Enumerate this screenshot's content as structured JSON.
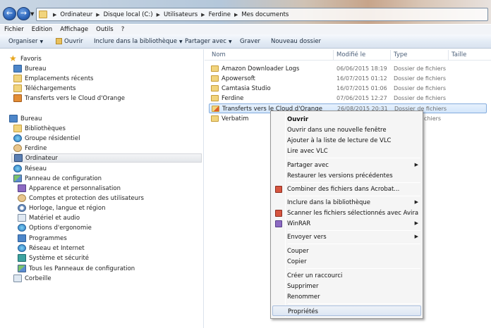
{
  "address": {
    "crumbs": [
      "Ordinateur",
      "Disque local (C:)",
      "Utilisateurs",
      "Ferdine",
      "Mes documents"
    ]
  },
  "menubar": {
    "items": [
      "Fichier",
      "Edition",
      "Affichage",
      "Outils",
      "?"
    ]
  },
  "toolbar": {
    "organize": "Organiser",
    "open": "Ouvrir",
    "include": "Inclure dans la bibliothèque",
    "share": "Partager avec",
    "burn": "Graver",
    "new_folder": "Nouveau dossier"
  },
  "nav": {
    "favorites": "Favoris",
    "desktop": "Bureau",
    "recent": "Emplacements récents",
    "downloads": "Téléchargements",
    "orange_cloud": "Transferts vers le Cloud d'Orange",
    "bureau_root": "Bureau",
    "libraries": "Bibliothèques",
    "homegroup": "Groupe résidentiel",
    "user": "Ferdine",
    "computer": "Ordinateur",
    "network": "Réseau",
    "control_panel": "Panneau de configuration",
    "cp_items": [
      "Apparence et personnalisation",
      "Comptes et protection des utilisateurs",
      "Horloge, langue et région",
      "Matériel et audio",
      "Options d'ergonomie",
      "Programmes",
      "Réseau et Internet",
      "Système et sécurité",
      "Tous les Panneaux de configuration"
    ],
    "recycle_bin": "Corbeille"
  },
  "columns": {
    "name": "Nom",
    "modified": "Modifié le",
    "type": "Type",
    "size": "Taille"
  },
  "files": [
    {
      "name": "Amazon Downloader Logs",
      "date": "06/06/2015 18:19",
      "type": "Dossier de fichiers"
    },
    {
      "name": "Apowersoft",
      "date": "16/07/2015 01:12",
      "type": "Dossier de fichiers"
    },
    {
      "name": "Camtasia Studio",
      "date": "16/07/2015 01:06",
      "type": "Dossier de fichiers"
    },
    {
      "name": "Ferdine",
      "date": "07/06/2015 12:27",
      "type": "Dossier de fichiers"
    },
    {
      "name": "Transferts vers le Cloud d'Orange",
      "date": "26/08/2015 20:31",
      "type": "Dossier de fichiers"
    },
    {
      "name": "Verbatim",
      "date": "",
      "type": "chiers"
    }
  ],
  "context_menu": {
    "open": "Ouvrir",
    "open_new_window": "Ouvrir dans une nouvelle fenêtre",
    "vlc_add": "Ajouter à la liste de lecture de VLC",
    "vlc_play": "Lire avec VLC",
    "share_with": "Partager avec",
    "restore_versions": "Restaurer les versions précédentes",
    "acrobat_combine": "Combiner des fichiers dans Acrobat...",
    "include_library": "Inclure dans la bibliothèque",
    "avira_scan": "Scanner les fichiers sélectionnés avec Avira",
    "winrar": "WinRAR",
    "send_to": "Envoyer vers",
    "cut": "Couper",
    "copy": "Copier",
    "create_shortcut": "Créer un raccourci",
    "delete": "Supprimer",
    "rename": "Renommer",
    "properties": "Propriétés"
  }
}
